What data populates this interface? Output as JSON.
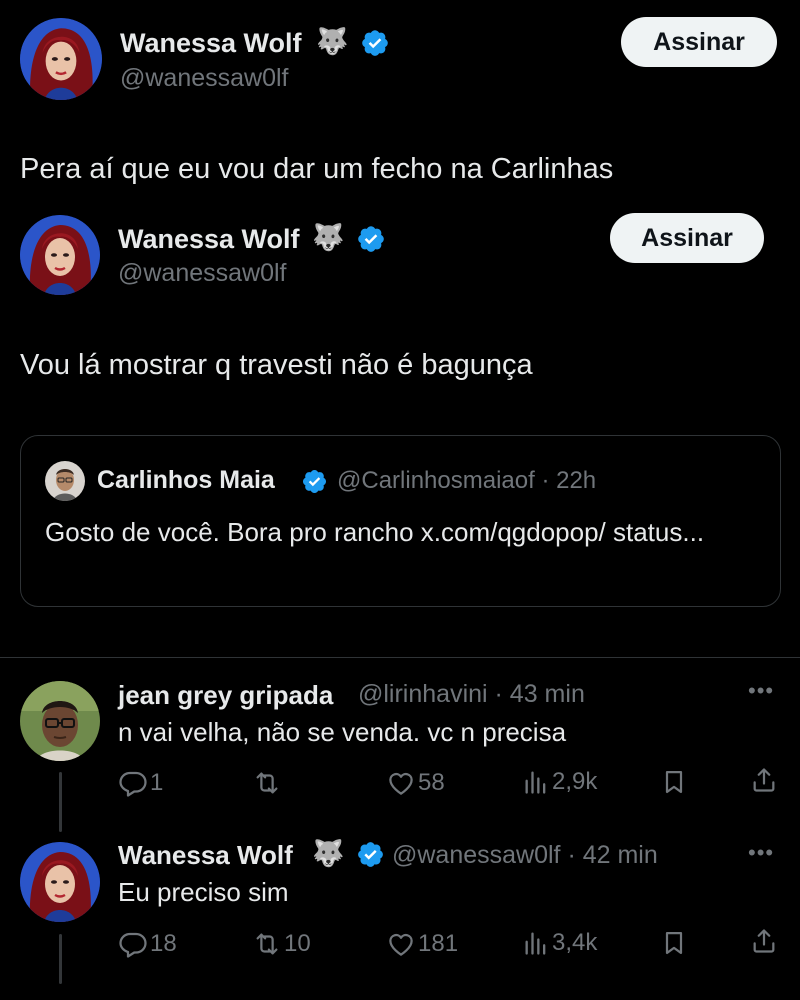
{
  "main_post": {
    "author": "Wanessa Wolf",
    "badge_emoji": "🐺",
    "handle": "@wanessaw0lf",
    "follow_label": "Assinar",
    "text": "Pera aí que eu vou dar um fecho na Carlinhas"
  },
  "inner_post": {
    "author": "Wanessa Wolf",
    "badge_emoji": "🐺",
    "handle": "@wanessaw0lf",
    "follow_label": "Assinar",
    "text": "Vou lá mostrar q travesti não é bagunça"
  },
  "quote": {
    "author": "Carlinhos Maia",
    "meta": "@Carlinhosmaiaof · 22h",
    "text": "Gosto de você. Bora pro rancho x.com/qgdopop/ status..."
  },
  "replies": [
    {
      "author": "jean grey gripada",
      "meta": "@lirinhavini · 43 min",
      "text": "n vai velha, não se venda. vc n precisa",
      "reply_count": "1",
      "retweet_count": "",
      "like_count": "58",
      "view_count": "2,9k"
    },
    {
      "author": "Wanessa Wolf",
      "badge_emoji": "🐺",
      "meta": "@wanessaw0lf · 42 min",
      "text": "Eu preciso sim",
      "reply_count": "18",
      "retweet_count": "10",
      "like_count": "181",
      "view_count": "3,4k"
    }
  ],
  "icons": {
    "verified": "verified-badge-icon",
    "reply": "reply-icon",
    "retweet": "retweet-icon",
    "like": "heart-icon",
    "views": "views-icon",
    "bookmark": "bookmark-icon",
    "share": "share-icon",
    "more": "more-icon"
  },
  "colors": {
    "background": "#000000",
    "text": "#e7e9ea",
    "muted": "#71767b",
    "verified": "#1d9bf0",
    "button_bg": "#eff3f4",
    "border": "#2f3336"
  }
}
